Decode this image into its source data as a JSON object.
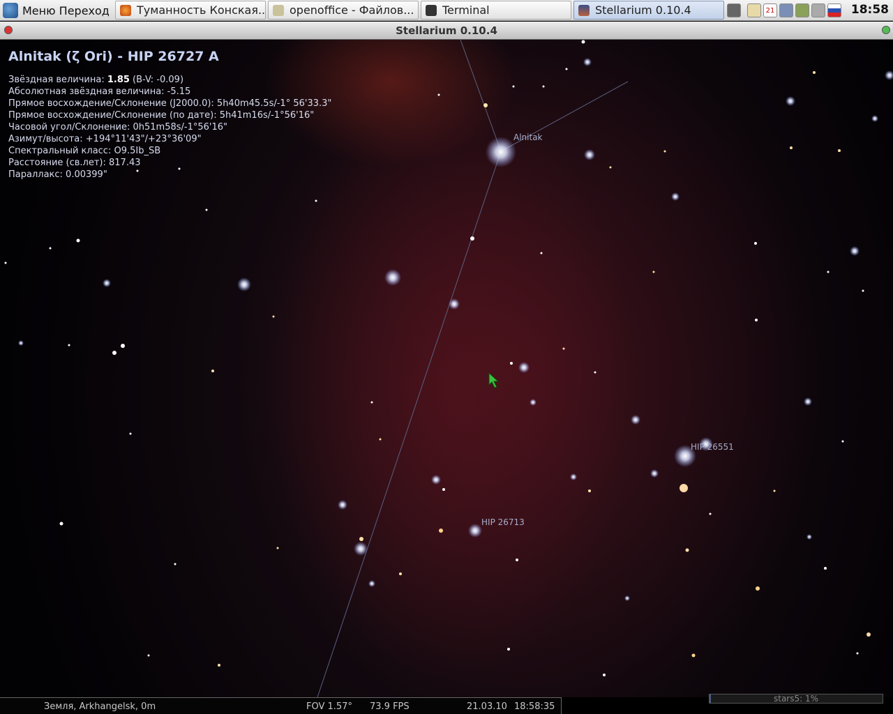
{
  "taskbar": {
    "menu_label": "Меню Переход",
    "tasks": [
      {
        "label": "Туманность Конская...",
        "icon": "firefox-icon"
      },
      {
        "label": "openoffice - Файлов...",
        "icon": "folder-icon"
      },
      {
        "label": "Terminal",
        "icon": "terminal-icon"
      },
      {
        "label": "Stellarium 0.10.4",
        "icon": "stellarium-icon",
        "active": true
      }
    ],
    "tray_icons": [
      "camera-icon",
      "clipboard-icon",
      "calendar-icon",
      "network-icon",
      "update-icon",
      "mail-icon",
      "keyboard-layout-flag-icon"
    ],
    "calendar_day": "21",
    "clock": "18:58"
  },
  "window": {
    "title": "Stellarium 0.10.4"
  },
  "object_info": {
    "name": "Alnitak (ζ Ori) - HIP 26727 A",
    "magnitude_label": "Звёздная величина: ",
    "magnitude_value": "1.85",
    "bv": " (B-V: -0.09)",
    "rows": [
      "Абсолютная звёздная величина: -5.15",
      "Прямое восхождение/Склонение (J2000.0): 5h40m45.5s/-1° 56'33.3\"",
      "Прямое восхождение/Склонение (по дате): 5h41m16s/-1°56'16\"",
      "Часовой угол/Склонение: 0h51m58s/-1°56'16\"",
      "Азимут/высота: +194°11'43\"/+23°36'09\"",
      "Спектральный класс: O9.5Ib_SB",
      "Расстояние (св.лет): 817.43",
      "Параллакс: 0.00399\""
    ]
  },
  "sky_labels": {
    "alnitak": "Alnitak",
    "hip_26551": "HIP 26551",
    "hip_26713": "HIP 26713"
  },
  "status_bar": {
    "location": "Земля, Arkhangelsk, 0m",
    "fov": "FOV 1.57°",
    "fps": "73.9 FPS",
    "date": "21.03.10",
    "time": "18:58:35"
  },
  "loader": {
    "label": "stars5: 1%",
    "progress_fraction": 0.01
  },
  "colors": {
    "taskbar_active": "#c3d2ea",
    "nebula_red": "#6a1520",
    "label_color": "#a8aecb"
  }
}
